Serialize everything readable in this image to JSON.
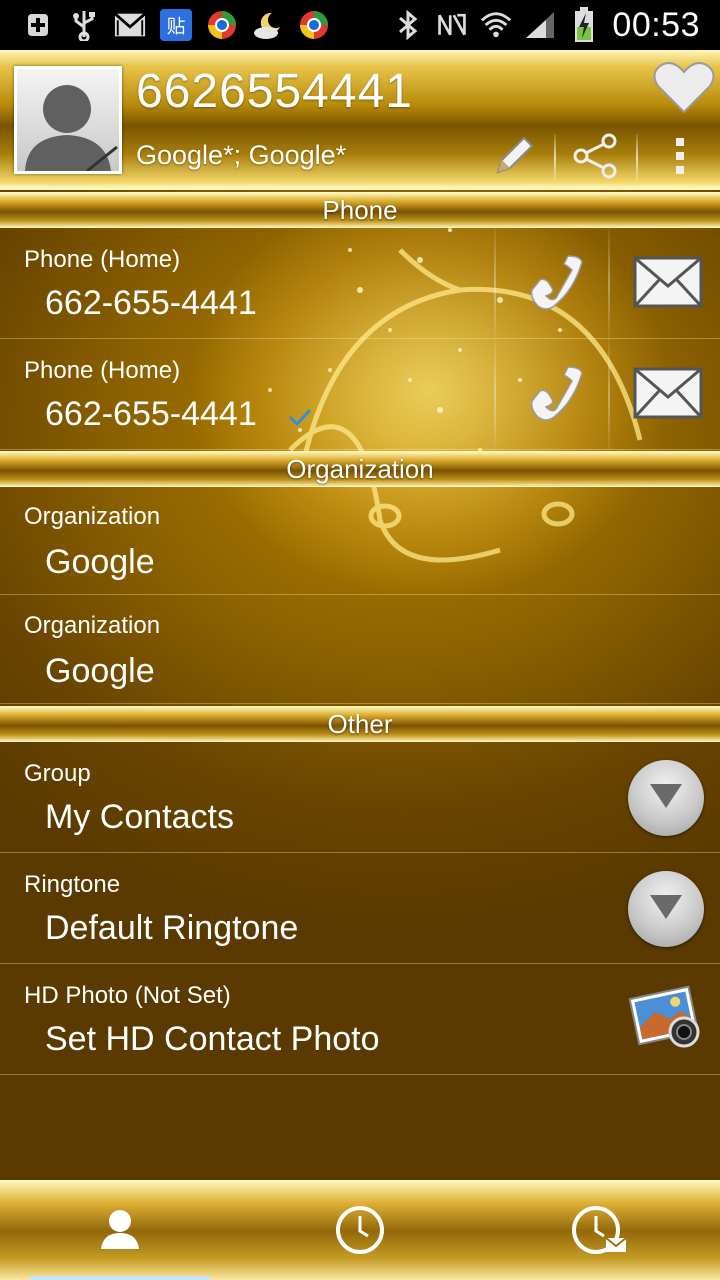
{
  "status_bar": {
    "time": "00:53",
    "left_icons": [
      "add-icon",
      "usb-icon",
      "gmail-icon",
      "tieba-icon",
      "chrome-like-icon",
      "weather-icon",
      "chrome-like-icon"
    ],
    "right_icons": [
      "bluetooth-icon",
      "nfc-off-icon",
      "wifi-icon",
      "signal-icon",
      "battery-charging-icon"
    ]
  },
  "header": {
    "name": "6626554441",
    "accounts": "Google*; Google*",
    "actions": [
      "edit",
      "share",
      "more"
    ],
    "favorite": false
  },
  "sections": {
    "phone": "Phone",
    "organization": "Organization",
    "other": "Other"
  },
  "phones": [
    {
      "label": "Phone  (Home)",
      "number": "662-655-4441",
      "default": false
    },
    {
      "label": "Phone  (Home)",
      "number": "662-655-4441",
      "default": true
    }
  ],
  "organizations": [
    {
      "label": "Organization",
      "value": "Google"
    },
    {
      "label": "Organization",
      "value": "Google"
    }
  ],
  "other": {
    "group": {
      "label": "Group",
      "value": "My Contacts"
    },
    "ringtone": {
      "label": "Ringtone",
      "value": "Default Ringtone"
    },
    "hd_photo": {
      "label": "HD Photo (Not Set)",
      "value": "Set HD Contact Photo"
    }
  },
  "bottom_nav": {
    "tabs": [
      "contact-icon",
      "history-icon",
      "missed-history-icon"
    ],
    "selected": 0
  },
  "colors": {
    "gold_light": "#fff3b0",
    "gold_dark": "#5f3d00",
    "accent_check": "#2f8fe0"
  }
}
